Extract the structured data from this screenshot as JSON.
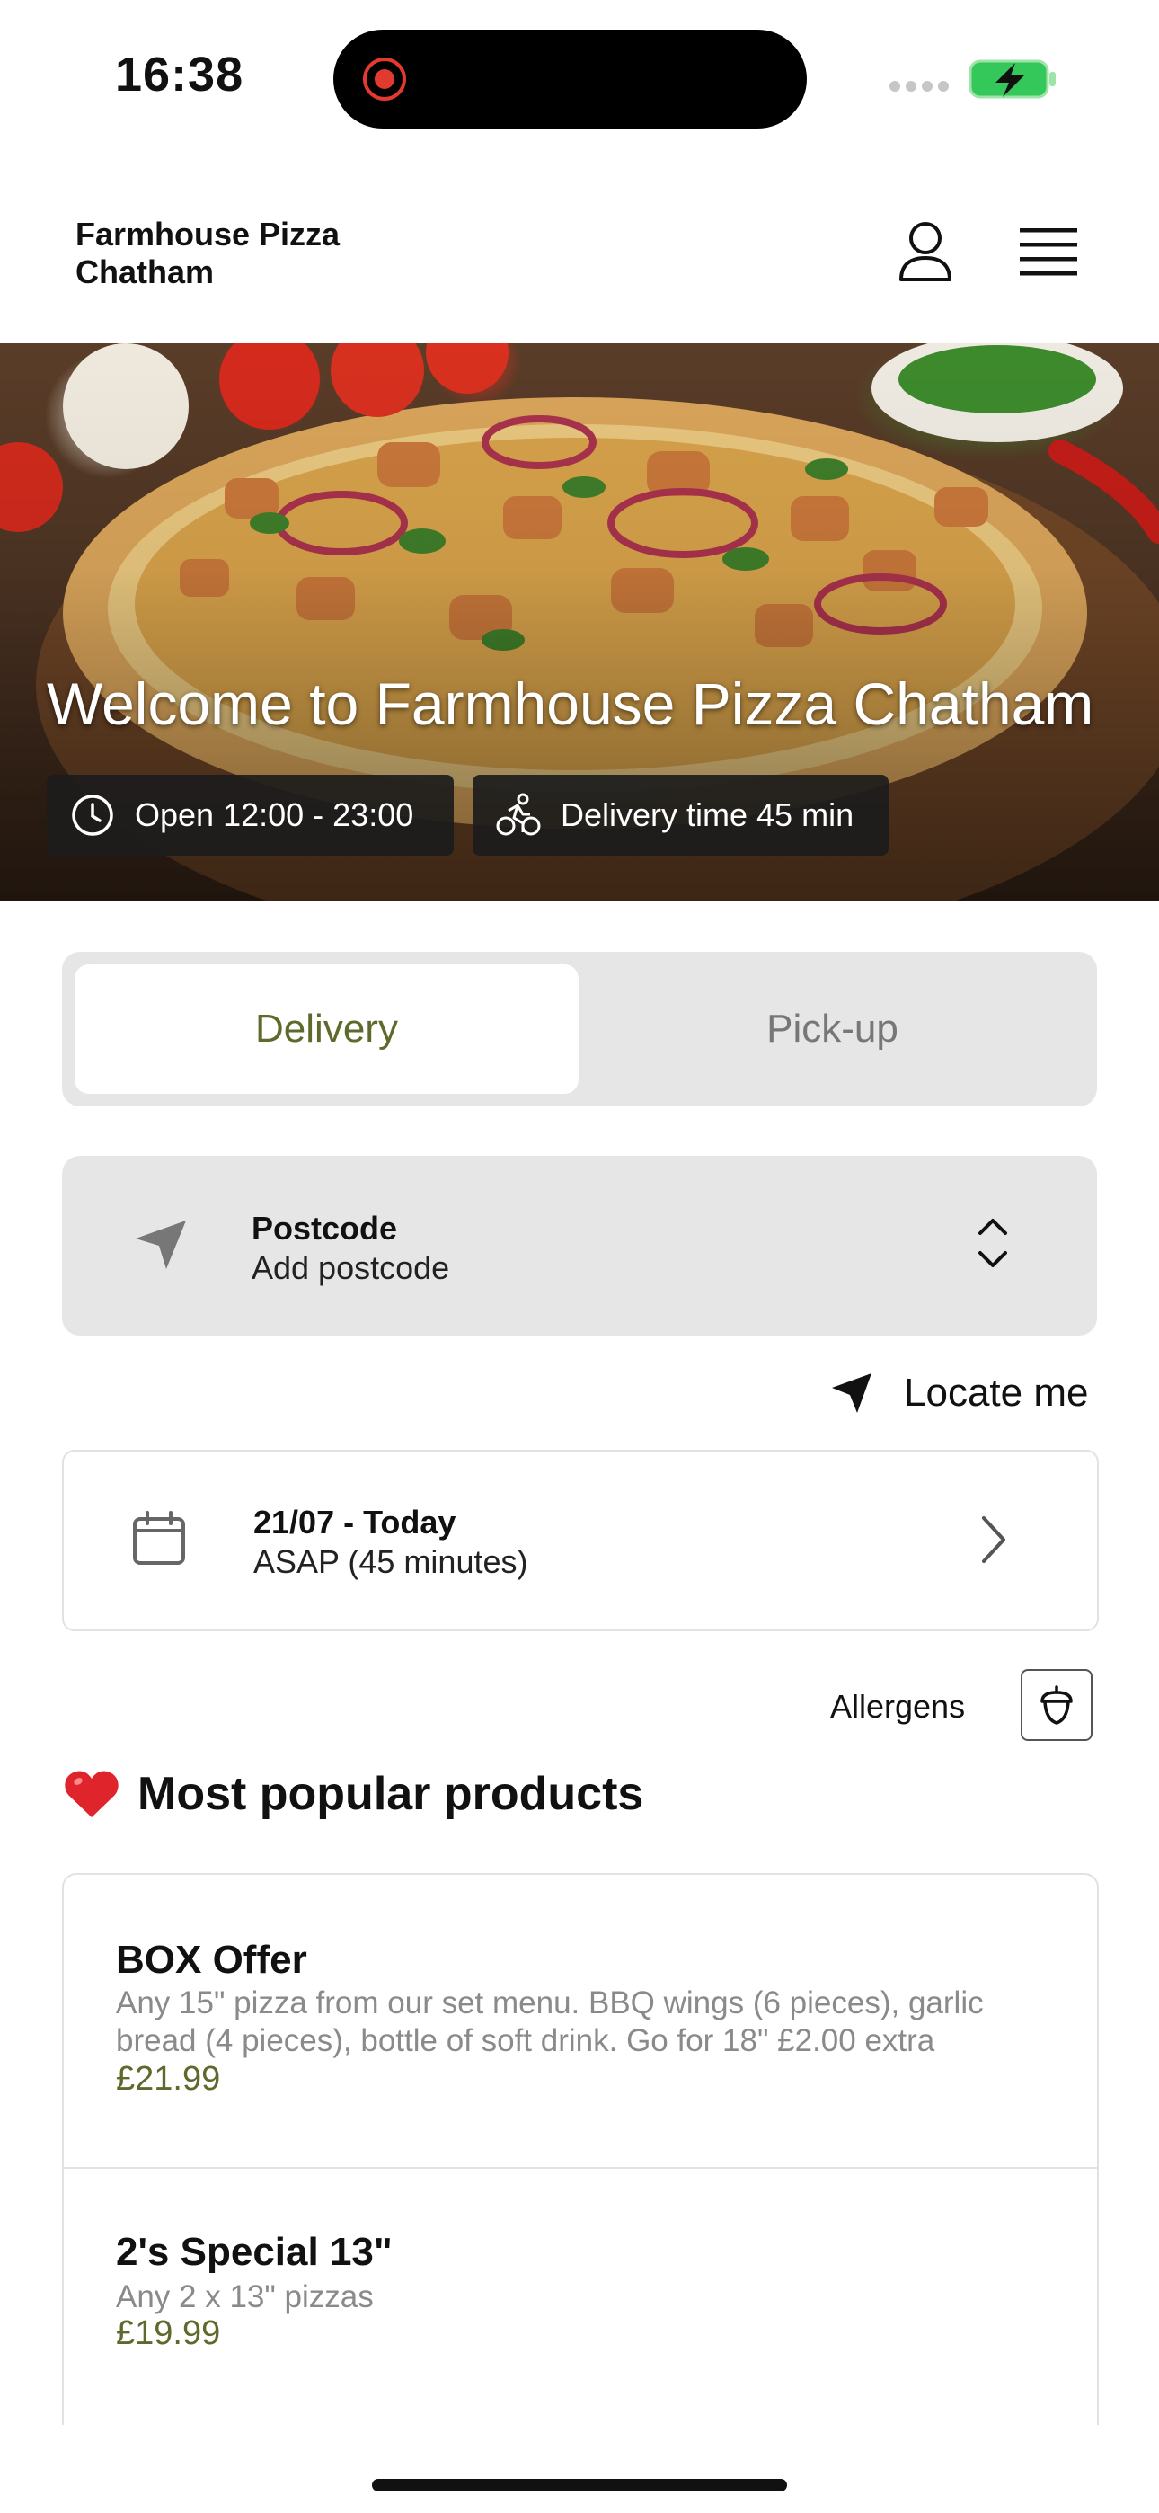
{
  "status_bar": {
    "time": "16:38"
  },
  "header": {
    "brand": "Farmhouse Pizza Chatham",
    "user_icon": "user-icon",
    "menu_icon": "hamburger-menu-icon"
  },
  "hero": {
    "title": "Welcome to Farmhouse Pizza Chatham",
    "open_hours": "Open 12:00 - 23:00",
    "delivery_time": "Delivery time 45 min"
  },
  "order_type": {
    "options": [
      "Delivery",
      "Pick-up"
    ],
    "selected": "Delivery"
  },
  "postcode": {
    "label": "Postcode",
    "value": "Add postcode"
  },
  "locate": {
    "label": "Locate me"
  },
  "schedule": {
    "date": "21/07 - Today",
    "time": "ASAP (45 minutes)"
  },
  "allergens": {
    "label": "Allergens"
  },
  "popular": {
    "title": "Most popular products",
    "products": [
      {
        "name": "BOX Offer",
        "description": "Any 15\" pizza from our set menu. BBQ wings (6 pieces), garlic bread (4 pieces), bottle of soft drink.  Go for 18\" £2.00 extra",
        "price": "£21.99"
      },
      {
        "name": "2's Special 13\"",
        "description": "Any 2 x 13\" pizzas",
        "price": "£19.99"
      }
    ]
  },
  "colors": {
    "accent": "#5e6a2c",
    "battery_green": "#34c759",
    "panel_grey": "#e6e6e6"
  }
}
